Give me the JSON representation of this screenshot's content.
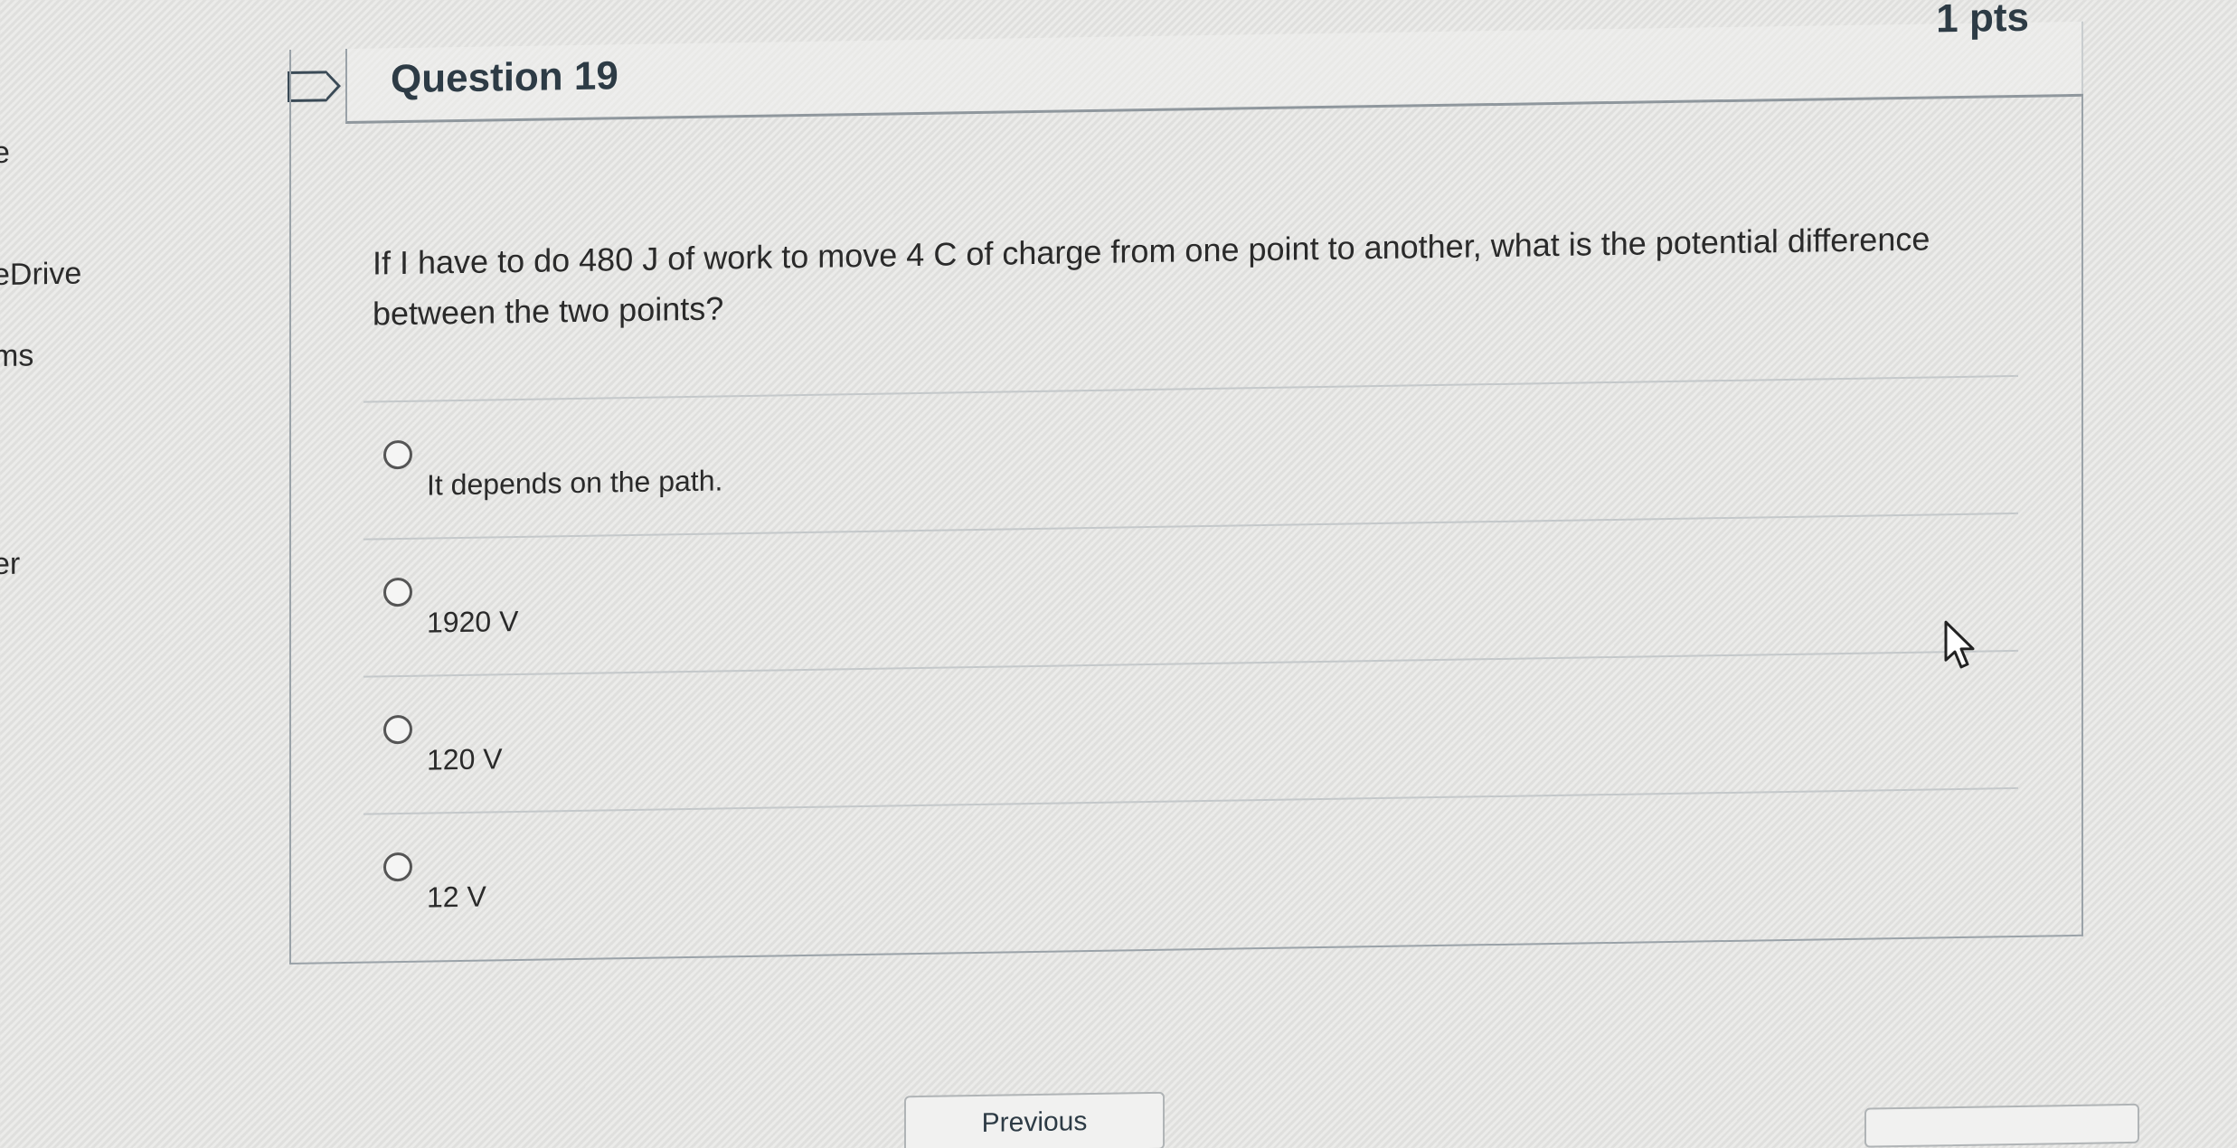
{
  "left_nav": {
    "items": [
      {
        "label": "e"
      },
      {
        "label": "eDrive"
      },
      {
        "label": "ms"
      },
      {
        "label": "er"
      }
    ]
  },
  "question": {
    "title": "Question 19",
    "points": "1 pts",
    "text": "If I have to do 480 J of work to move 4 C of charge from one point to another, what is the potential difference between the two points?",
    "answers": [
      {
        "label": "It depends on the path."
      },
      {
        "label": "1920 V"
      },
      {
        "label": "120 V"
      },
      {
        "label": "12 V"
      }
    ],
    "selected": null
  },
  "footer": {
    "previous_label": "Previous"
  },
  "colors": {
    "text": "#2d3b45",
    "border": "#9aa2a8"
  }
}
